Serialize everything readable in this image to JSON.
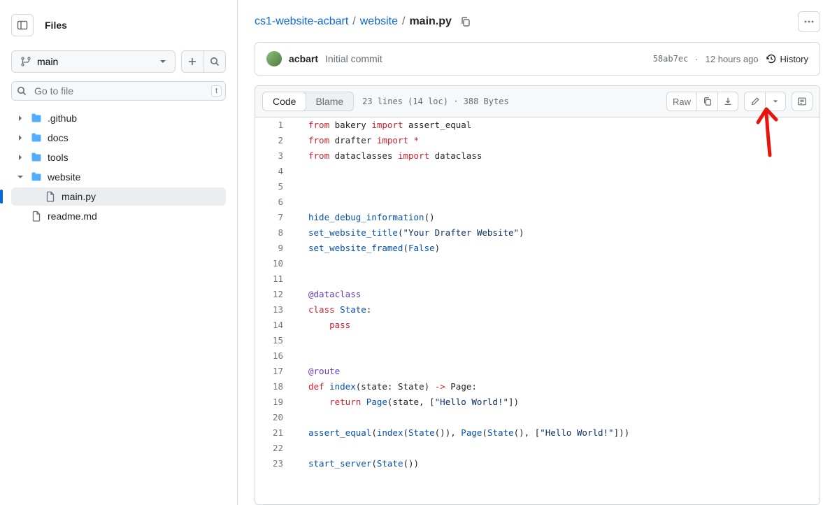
{
  "sidebar": {
    "title": "Files",
    "branch": "main",
    "search_placeholder": "Go to file",
    "kbd": "t",
    "tree": [
      {
        "name": ".github",
        "type": "folder",
        "expanded": false
      },
      {
        "name": "docs",
        "type": "folder",
        "expanded": false
      },
      {
        "name": "tools",
        "type": "folder",
        "expanded": false
      },
      {
        "name": "website",
        "type": "folder",
        "expanded": true,
        "children": [
          {
            "name": "main.py",
            "type": "file",
            "active": true
          }
        ]
      },
      {
        "name": "readme.md",
        "type": "file"
      }
    ]
  },
  "breadcrumb": {
    "parts": [
      {
        "text": "cs1-website-acbart",
        "link": true
      },
      {
        "text": "website",
        "link": true
      },
      {
        "text": "main.py",
        "link": false
      }
    ]
  },
  "commit": {
    "author": "acbart",
    "message": "Initial commit",
    "sha": "58ab7ec",
    "time": "12 hours ago",
    "history_label": "History"
  },
  "code_header": {
    "tab_code": "Code",
    "tab_blame": "Blame",
    "meta": "23 lines (14 loc) · 388 Bytes",
    "raw_label": "Raw"
  },
  "code": {
    "lines": [
      {
        "n": 1,
        "tokens": [
          [
            "k",
            "from"
          ],
          [
            "",
            " bakery "
          ],
          [
            "k",
            "import"
          ],
          [
            "",
            " assert_equal"
          ]
        ]
      },
      {
        "n": 2,
        "tokens": [
          [
            "k",
            "from"
          ],
          [
            "",
            " drafter "
          ],
          [
            "k",
            "import"
          ],
          [
            "",
            " "
          ],
          [
            "k",
            "*"
          ]
        ]
      },
      {
        "n": 3,
        "tokens": [
          [
            "k",
            "from"
          ],
          [
            "",
            " dataclasses "
          ],
          [
            "k",
            "import"
          ],
          [
            "",
            " dataclass"
          ]
        ]
      },
      {
        "n": 4,
        "tokens": []
      },
      {
        "n": 5,
        "tokens": []
      },
      {
        "n": 6,
        "tokens": []
      },
      {
        "n": 7,
        "tokens": [
          [
            "c1",
            "hide_debug_information"
          ],
          [
            "",
            "()"
          ]
        ]
      },
      {
        "n": 8,
        "tokens": [
          [
            "c1",
            "set_website_title"
          ],
          [
            "",
            "("
          ],
          [
            "s",
            "\"Your Drafter Website\""
          ],
          [
            "",
            ")"
          ]
        ]
      },
      {
        "n": 9,
        "tokens": [
          [
            "c1",
            "set_website_framed"
          ],
          [
            "",
            "("
          ],
          [
            "d",
            "False"
          ],
          [
            "",
            ")"
          ]
        ]
      },
      {
        "n": 10,
        "tokens": []
      },
      {
        "n": 11,
        "tokens": []
      },
      {
        "n": 12,
        "tokens": [
          [
            "en",
            "@dataclass"
          ]
        ]
      },
      {
        "n": 13,
        "tokens": [
          [
            "k",
            "class"
          ],
          [
            "",
            " "
          ],
          [
            "c1",
            "State"
          ],
          [
            "",
            ":"
          ]
        ]
      },
      {
        "n": 14,
        "tokens": [
          [
            "",
            "    "
          ],
          [
            "k",
            "pass"
          ]
        ]
      },
      {
        "n": 15,
        "tokens": []
      },
      {
        "n": 16,
        "tokens": []
      },
      {
        "n": 17,
        "tokens": [
          [
            "en",
            "@route"
          ]
        ]
      },
      {
        "n": 18,
        "tokens": [
          [
            "k",
            "def"
          ],
          [
            "",
            " "
          ],
          [
            "c1",
            "index"
          ],
          [
            "",
            "("
          ],
          [
            "",
            "state"
          ],
          [
            "",
            ": "
          ],
          [
            "",
            "State"
          ],
          [
            "",
            ") "
          ],
          [
            "k",
            "->"
          ],
          [
            "",
            " "
          ],
          [
            "",
            "Page"
          ],
          [
            "",
            ":"
          ]
        ]
      },
      {
        "n": 19,
        "tokens": [
          [
            "",
            "    "
          ],
          [
            "k",
            "return"
          ],
          [
            "",
            " "
          ],
          [
            "c1",
            "Page"
          ],
          [
            "",
            "(state, ["
          ],
          [
            "s",
            "\"Hello World!\""
          ],
          [
            "",
            "])"
          ]
        ]
      },
      {
        "n": 20,
        "tokens": []
      },
      {
        "n": 21,
        "tokens": [
          [
            "c1",
            "assert_equal"
          ],
          [
            "",
            "("
          ],
          [
            "c1",
            "index"
          ],
          [
            "",
            "("
          ],
          [
            "c1",
            "State"
          ],
          [
            "",
            "()), "
          ],
          [
            "c1",
            "Page"
          ],
          [
            "",
            "("
          ],
          [
            "c1",
            "State"
          ],
          [
            "",
            "(), ["
          ],
          [
            "s",
            "\"Hello World!\""
          ],
          [
            "",
            "]))"
          ]
        ]
      },
      {
        "n": 22,
        "tokens": []
      },
      {
        "n": 23,
        "tokens": [
          [
            "c1",
            "start_server"
          ],
          [
            "",
            "("
          ],
          [
            "c1",
            "State"
          ],
          [
            "",
            "())"
          ]
        ]
      }
    ]
  }
}
